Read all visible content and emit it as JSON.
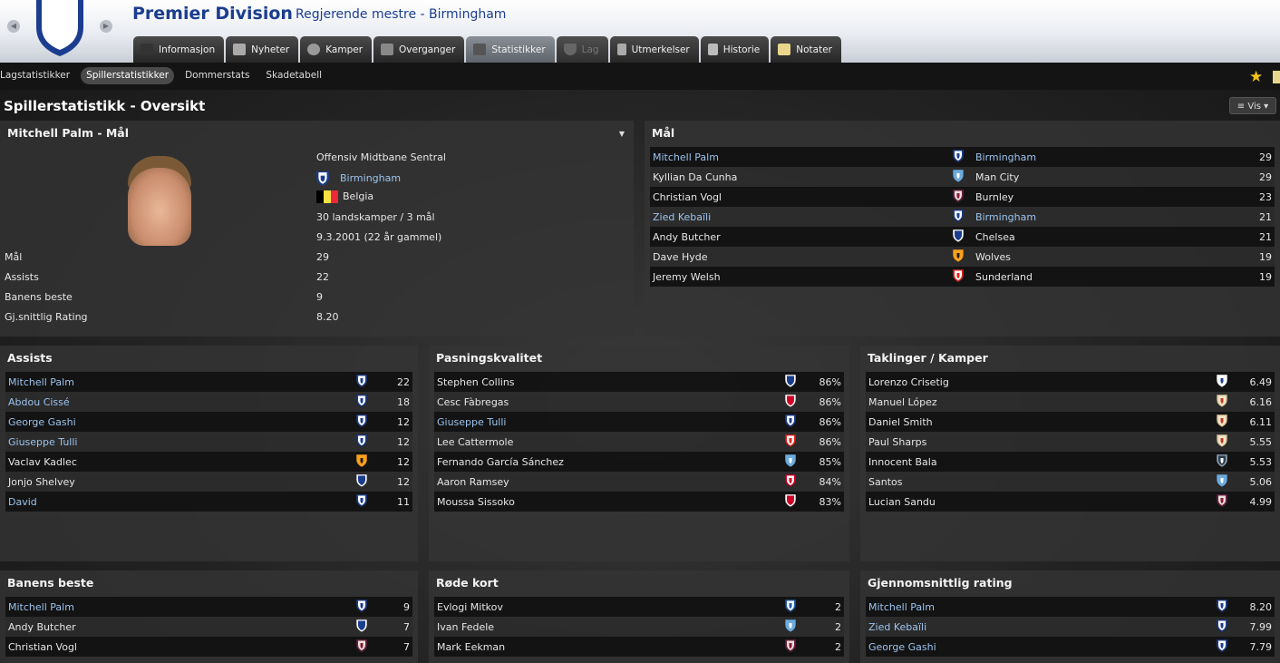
{
  "header": {
    "title": "Premier Division",
    "subtitle": "Regjerende mestre - Birmingham",
    "tabs": [
      {
        "label": "Informasjon",
        "state": "normal"
      },
      {
        "label": "Nyheter",
        "state": "normal"
      },
      {
        "label": "Kamper",
        "state": "normal"
      },
      {
        "label": "Overganger",
        "state": "normal"
      },
      {
        "label": "Statistikker",
        "state": "active"
      },
      {
        "label": "Lag",
        "state": "disabled"
      },
      {
        "label": "Utmerkelser",
        "state": "normal"
      },
      {
        "label": "Historie",
        "state": "normal"
      },
      {
        "label": "Notater",
        "state": "normal"
      }
    ]
  },
  "subtabs": [
    {
      "label": "Lagstatistikker",
      "active": false
    },
    {
      "label": "Spillerstatistikker",
      "active": true
    },
    {
      "label": "Dommerstats",
      "active": false
    },
    {
      "label": "Skadetabell",
      "active": false
    }
  ],
  "page_title": "Spillerstatistikk - Oversikt",
  "vis_label": "Vis",
  "colors": {
    "link": "#9cc3ee",
    "title_blue": "#1b3d8f",
    "star": "#f0c419"
  },
  "profile": {
    "title": "Mitchell Palm - Mål",
    "position": "Offensiv Midtbane Sentral",
    "club": "Birmingham",
    "nation": "Belgia",
    "caps": "30 landskamper / 3 mål",
    "born": "9.3.2001 (22 år gammel)",
    "stats": [
      {
        "label": "Mål",
        "value": "29"
      },
      {
        "label": "Assists",
        "value": "22"
      },
      {
        "label": "Banens beste",
        "value": "9"
      },
      {
        "label": "Gj.snittlig Rating",
        "value": "8.20"
      }
    ]
  },
  "goals": {
    "title": "Mål",
    "rows": [
      {
        "name": "Mitchell Palm",
        "club": "Birmingham",
        "value": "29",
        "link": true,
        "club_link": true,
        "crest": "birmingham"
      },
      {
        "name": "Kyllian Da Cunha",
        "club": "Man City",
        "value": "29",
        "link": false,
        "club_link": false,
        "crest": "mancity"
      },
      {
        "name": "Christian Vogl",
        "club": "Burnley",
        "value": "23",
        "link": false,
        "club_link": false,
        "crest": "burnley"
      },
      {
        "name": "Zied Kebaïli",
        "club": "Birmingham",
        "value": "21",
        "link": true,
        "club_link": true,
        "crest": "birmingham"
      },
      {
        "name": "Andy Butcher",
        "club": "Chelsea",
        "value": "21",
        "link": false,
        "club_link": false,
        "crest": "chelsea"
      },
      {
        "name": "Dave Hyde",
        "club": "Wolves",
        "value": "19",
        "link": false,
        "club_link": false,
        "crest": "wolves"
      },
      {
        "name": "Jeremy Welsh",
        "club": "Sunderland",
        "value": "19",
        "link": false,
        "club_link": false,
        "crest": "sunderland"
      }
    ]
  },
  "assists": {
    "title": "Assists",
    "rows": [
      {
        "name": "Mitchell Palm",
        "value": "22",
        "link": true,
        "crest": "birmingham"
      },
      {
        "name": "Abdou Cissé",
        "value": "18",
        "link": true,
        "crest": "birmingham"
      },
      {
        "name": "George Gashi",
        "value": "12",
        "link": true,
        "crest": "birmingham"
      },
      {
        "name": "Giuseppe Tulli",
        "value": "12",
        "link": true,
        "crest": "birmingham"
      },
      {
        "name": "Vaclav Kadlec",
        "value": "12",
        "link": false,
        "crest": "wolves"
      },
      {
        "name": "Jonjo Shelvey",
        "value": "12",
        "link": false,
        "crest": "chelsea"
      },
      {
        "name": "David",
        "value": "11",
        "link": true,
        "crest": "birmingham"
      }
    ]
  },
  "passing": {
    "title": "Pasningskvalitet",
    "rows": [
      {
        "name": "Stephen Collins",
        "value": "86%",
        "link": false,
        "crest": "chelsea"
      },
      {
        "name": "Cesc Fàbregas",
        "value": "86%",
        "link": false,
        "crest": "arsenal"
      },
      {
        "name": "Giuseppe Tulli",
        "value": "86%",
        "link": true,
        "crest": "birmingham"
      },
      {
        "name": "Lee Cattermole",
        "value": "86%",
        "link": false,
        "crest": "sunderland"
      },
      {
        "name": "Fernando García Sánchez",
        "value": "85%",
        "link": false,
        "crest": "mancity"
      },
      {
        "name": "Aaron Ramsey",
        "value": "84%",
        "link": false,
        "crest": "arsenal2"
      },
      {
        "name": "Moussa Sissoko",
        "value": "83%",
        "link": false,
        "crest": "arsenal"
      }
    ]
  },
  "tackles": {
    "title": "Taklinger / Kamper",
    "rows": [
      {
        "name": "Lorenzo Crisetig",
        "value": "6.49",
        "link": false,
        "crest": "white"
      },
      {
        "name": "Manuel López",
        "value": "6.16",
        "link": false,
        "crest": "bristol"
      },
      {
        "name": "Daniel Smith",
        "value": "6.11",
        "link": false,
        "crest": "bristol"
      },
      {
        "name": "Paul Sharps",
        "value": "5.55",
        "link": false,
        "crest": "bristol"
      },
      {
        "name": "Innocent Bala",
        "value": "5.53",
        "link": false,
        "crest": "newcastle"
      },
      {
        "name": "Santos",
        "value": "5.06",
        "link": false,
        "crest": "mancity"
      },
      {
        "name": "Lucian Sandu",
        "value": "4.99",
        "link": false,
        "crest": "burnley"
      }
    ]
  },
  "motm": {
    "title": "Banens beste",
    "rows": [
      {
        "name": "Mitchell Palm",
        "value": "9",
        "link": true,
        "crest": "birmingham"
      },
      {
        "name": "Andy Butcher",
        "value": "7",
        "link": false,
        "crest": "chelsea"
      },
      {
        "name": "Christian Vogl",
        "value": "7",
        "link": false,
        "crest": "burnley"
      }
    ]
  },
  "red_cards": {
    "title": "Røde kort",
    "rows": [
      {
        "name": "Evlogi Mitkov",
        "value": "2",
        "link": false,
        "crest": "qpr"
      },
      {
        "name": "Ivan Fedele",
        "value": "2",
        "link": false,
        "crest": "mancity"
      },
      {
        "name": "Mark Eekman",
        "value": "2",
        "link": false,
        "crest": "burnley"
      }
    ]
  },
  "avg_rating": {
    "title": "Gjennomsnittlig rating",
    "rows": [
      {
        "name": "Mitchell Palm",
        "value": "8.20",
        "link": true,
        "crest": "birmingham"
      },
      {
        "name": "Zied Kebaïli",
        "value": "7.99",
        "link": true,
        "crest": "birmingham"
      },
      {
        "name": "George Gashi",
        "value": "7.79",
        "link": true,
        "crest": "birmingham"
      }
    ]
  }
}
